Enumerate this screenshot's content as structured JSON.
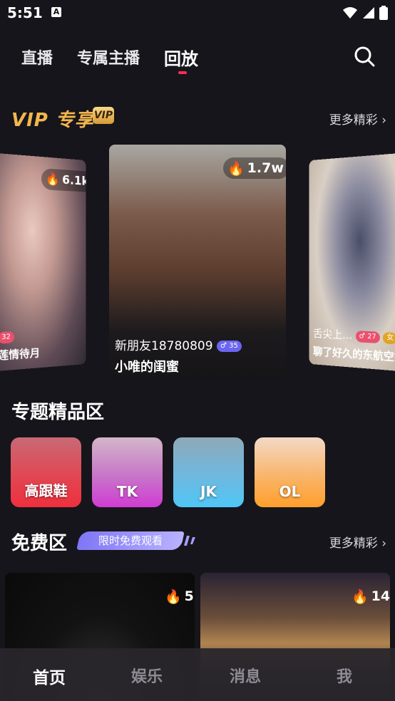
{
  "status_bar": {
    "time": "5:51",
    "a_icon": "A",
    "icons": [
      "wifi-icon",
      "signal-icon",
      "battery-icon"
    ]
  },
  "top_nav": {
    "tabs": [
      {
        "label": "直播",
        "active": false
      },
      {
        "label": "专属主播",
        "active": false
      },
      {
        "label": "回放",
        "active": true
      }
    ],
    "search_icon": "search-icon"
  },
  "vip_section": {
    "title": "VIP 专享",
    "badge": "VIP",
    "more": "更多精彩 ›",
    "cards": [
      {
        "hot": "6.1k",
        "name": "",
        "gender_age": "32",
        "title": "莲情待月"
      },
      {
        "hot": "1.7w",
        "name": "新朋友18780809",
        "gender_age": "♂ 35",
        "title": "小唯的闺蜜"
      },
      {
        "hot": "",
        "name": "舌尖上…",
        "gender_age": "♂ 27",
        "gender_age2": "女",
        "title": "聊了好久的东航空姐"
      }
    ]
  },
  "topic_section": {
    "title": "专题精品区",
    "topics": [
      {
        "label": "高跟鞋"
      },
      {
        "label": "TK"
      },
      {
        "label": "JK"
      },
      {
        "label": "OL"
      }
    ]
  },
  "free_section": {
    "title": "免费区",
    "tag": "限时免费观看",
    "more": "更多精彩 ›",
    "cards": [
      {
        "hot": "5"
      },
      {
        "hot": "14"
      }
    ]
  },
  "bottom_nav": {
    "items": [
      {
        "label": "首页",
        "active": true
      },
      {
        "label": "娱乐",
        "active": false
      },
      {
        "label": "消息",
        "active": false
      },
      {
        "label": "我",
        "active": false
      }
    ]
  },
  "colors": {
    "background": "#16151b",
    "accent": "#ff2d55",
    "vip_gold": "#f3b64d",
    "free_tag": "#8f87f7"
  }
}
